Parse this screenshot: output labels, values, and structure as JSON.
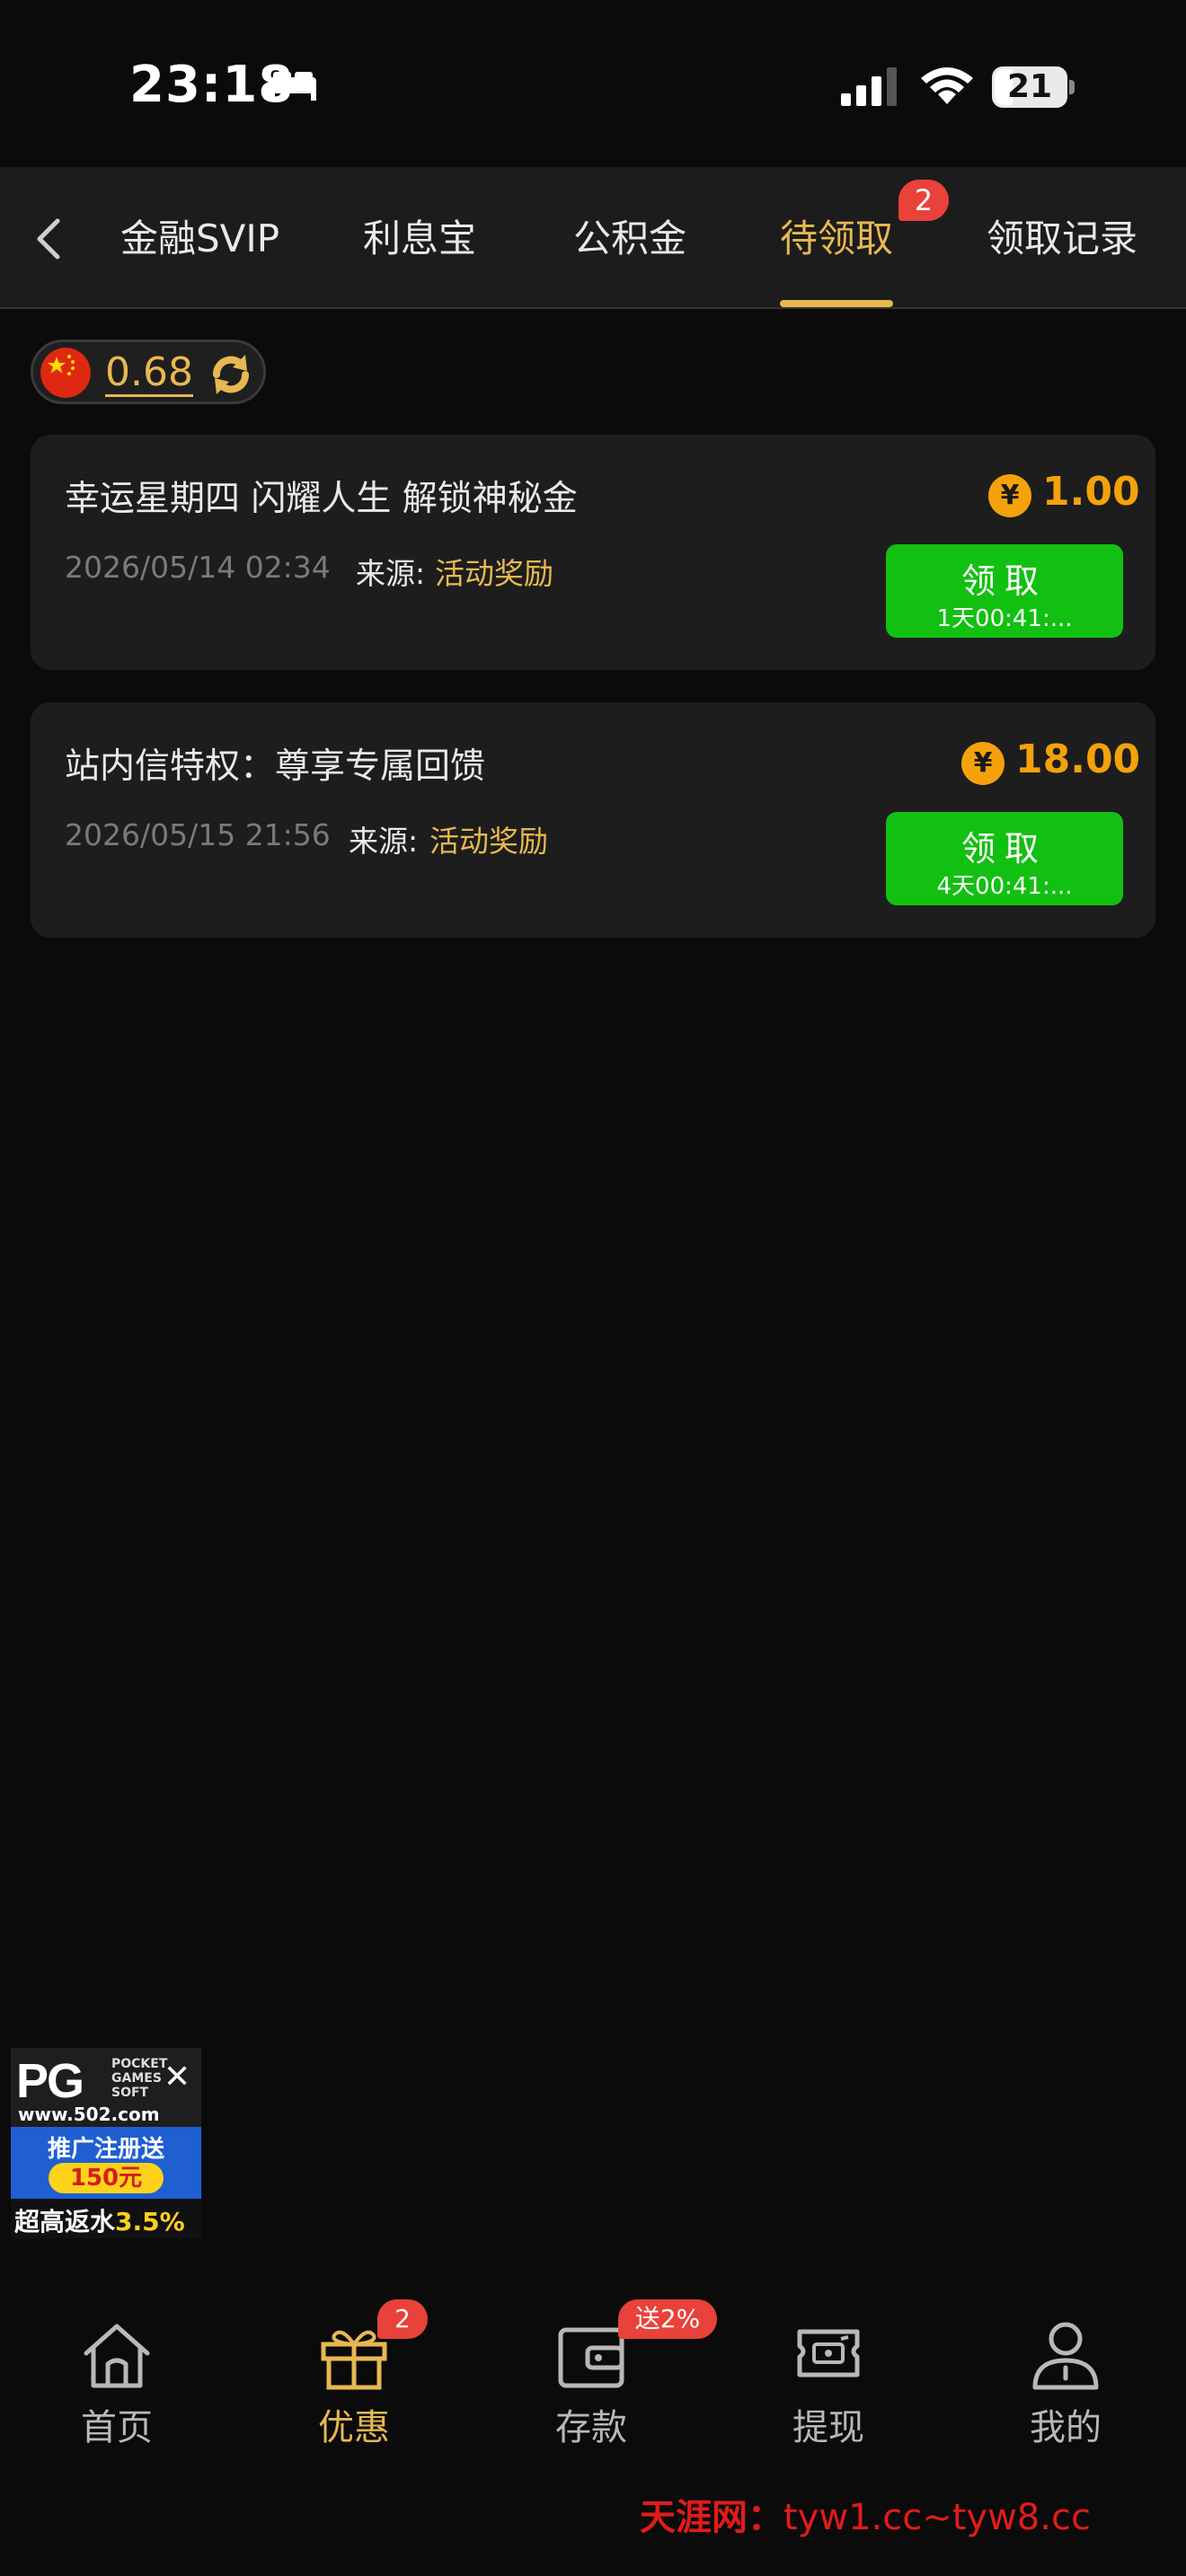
{
  "status_bar": {
    "time": "23:18",
    "battery": "21"
  },
  "tabs": {
    "items": [
      {
        "label": "金融SVIP"
      },
      {
        "label": "利息宝"
      },
      {
        "label": "公积金"
      },
      {
        "label": "待领取",
        "active": true
      },
      {
        "label": "领取记录"
      }
    ],
    "badge": "2"
  },
  "balance": {
    "value": "0.68"
  },
  "rewards": [
    {
      "title": "幸运星期四 闪耀人生 解锁神秘金",
      "date": "2026/05/14 02:34",
      "source_label": "来源:",
      "source": "活动奖励",
      "currency_symbol": "¥",
      "amount": "1.00",
      "claim_label": "领取",
      "countdown": "1天00:41:..."
    },
    {
      "title": "站内信特权：尊享专属回馈",
      "date": "2026/05/15 21:56",
      "source_label": "来源:",
      "source": "活动奖励",
      "currency_symbol": "¥",
      "amount": "18.00",
      "claim_label": "领取",
      "countdown": "4天00:41:..."
    }
  ],
  "ad": {
    "brand": "PG",
    "sub_brand": "POCKET GAMES SOFT",
    "url": "www.502.com",
    "promo_line": "推广注册送",
    "bonus": "150元",
    "rebate_label": "超高返水",
    "rebate_value": "3.5%"
  },
  "bottom_nav": {
    "items": [
      {
        "label": "首页",
        "icon": "home-icon"
      },
      {
        "label": "优惠",
        "icon": "gift-icon",
        "active": true,
        "badge": "2"
      },
      {
        "label": "存款",
        "icon": "wallet-icon",
        "badge": "送2%"
      },
      {
        "label": "提现",
        "icon": "withdraw-icon"
      },
      {
        "label": "我的",
        "icon": "profile-icon"
      }
    ]
  },
  "watermark": {
    "site": "天涯网：",
    "domains": "tyw1.cc~tyw8.cc"
  },
  "colors": {
    "accent": "#e7b851",
    "claim": "#12c012",
    "badge": "#e8423a",
    "coin": "#f4a20b"
  }
}
